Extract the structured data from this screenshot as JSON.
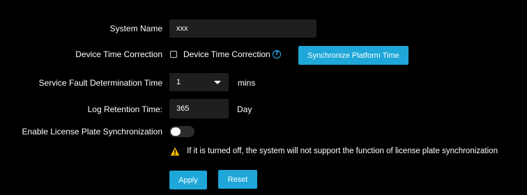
{
  "form": {
    "system_name": {
      "label": "System Name",
      "value": "xxx"
    },
    "device_time_correction": {
      "label": "Device Time Correction",
      "checkbox_label": "Device Time Correction",
      "checked": false,
      "sync_button_label": "Synchronize Platform Time"
    },
    "service_fault": {
      "label": "Service Fault Determination Time",
      "value": "1",
      "unit": "mins"
    },
    "log_retention": {
      "label": "Log Retention Time:",
      "value": "365",
      "unit": "Day"
    },
    "license_plate_sync": {
      "label": "Enable License Plate Synchronization",
      "enabled": false,
      "warning": "If it is turned off, the system will not support the function of license plate synchronization"
    }
  },
  "actions": {
    "apply_label": "Apply",
    "reset_label": "Reset"
  },
  "colors": {
    "background": "#000000",
    "field_background": "#1f1f1f",
    "accent": "#1ea7d8",
    "help_icon": "#29b6f6",
    "warning": "#f2b600"
  },
  "icons": {
    "help": "question-circle-icon",
    "warning": "warning-triangle-icon",
    "select": "chevron-down-icon"
  }
}
